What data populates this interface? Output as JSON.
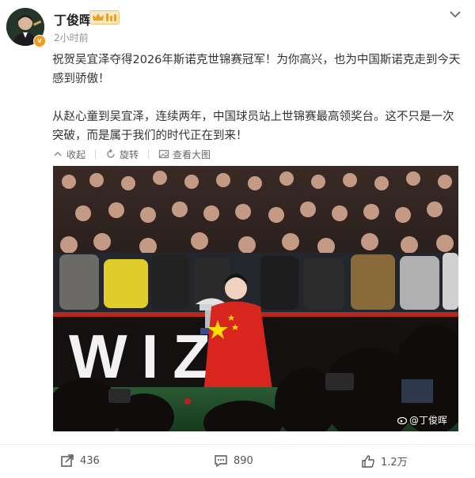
{
  "header": {
    "username": "丁俊晖",
    "avatar_badge": "v",
    "timestamp": "2小时前",
    "more_icon": "chevron-down-icon"
  },
  "post": {
    "paragraph_1": "祝贺吴宜泽夺得2026年斯诺克世锦赛冠军！为你高兴，也为中国斯诺克走到今天感到骄傲！",
    "paragraph_2": "从赵心童到吴宜泽，连续两年，中国球员站上世锦赛最高领奖台。这不只是一次突破，而是属于我们的时代正在到来！"
  },
  "image_actions": {
    "collect": "收起",
    "rotate": "旋转",
    "view_large": "查看大图"
  },
  "photo": {
    "sponsor_text": "WIZ",
    "watermark": "@丁俊晖",
    "flag_color": "#d8261f"
  },
  "footer": {
    "repost_count": "436",
    "comment_count": "890",
    "like_count": "1.2万"
  },
  "colors": {
    "accent_gold": "#f39a1e",
    "meta_gray": "#939393",
    "divider": "#eeeeee"
  }
}
